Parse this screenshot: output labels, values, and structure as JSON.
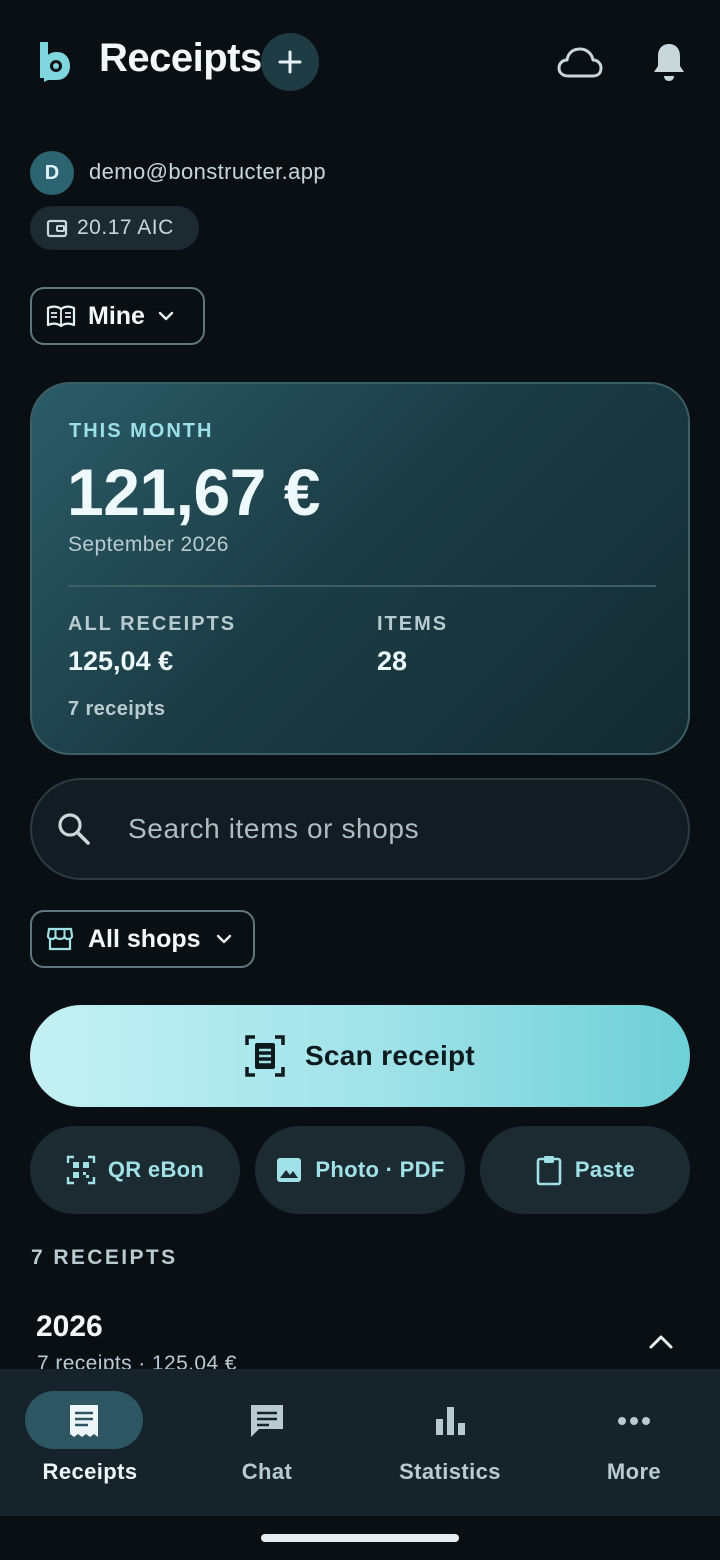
{
  "header": {
    "title": "Receipts",
    "add_icon": "plus-icon",
    "cloud_icon": "cloud-icon",
    "bell_icon": "bell-icon",
    "logo_icon": "bonstructer-logo"
  },
  "account": {
    "avatar_initial": "D",
    "email": "demo@bonstructer.app",
    "credits": "20.17 AIC",
    "credits_icon": "wallet-icon"
  },
  "book_filter": {
    "label": "Mine",
    "icon": "book-open-icon"
  },
  "summary": {
    "this_month_label": "THIS MONTH",
    "this_month_total": "121,67 €",
    "month": "September 2026",
    "all_receipts_label": "ALL RECEIPTS",
    "all_receipts_total": "125,04 €",
    "receipts_count": "7 receipts",
    "items_label": "ITEMS",
    "items_count": "28"
  },
  "search": {
    "placeholder": "Search items or shops",
    "icon": "search-icon"
  },
  "shop_filter": {
    "label": "All shops",
    "icon": "store-icon"
  },
  "scan": {
    "label": "Scan receipt",
    "icon": "document-scanner-icon"
  },
  "import_actions": [
    {
      "label": "QR eBon",
      "icon": "qr-code-icon"
    },
    {
      "label": "Photo · PDF",
      "icon": "image-icon"
    },
    {
      "label": "Paste",
      "icon": "clipboard-icon"
    }
  ],
  "list": {
    "section_title": "7 RECEIPTS",
    "groups": [
      {
        "year": "2026",
        "summary": "7 receipts · 125,04 €",
        "expanded": true
      }
    ]
  },
  "bottom_nav": [
    {
      "label": "Receipts",
      "icon": "receipt-icon",
      "active": true
    },
    {
      "label": "Chat",
      "icon": "chat-icon",
      "active": false
    },
    {
      "label": "Statistics",
      "icon": "bar-chart-icon",
      "active": false
    },
    {
      "label": "More",
      "icon": "more-horizontal-icon",
      "active": false
    }
  ],
  "colors": {
    "background": "#0a0f13",
    "accent": "#9fe1e7",
    "card": "#1c3d46",
    "nav": "#16232a"
  }
}
